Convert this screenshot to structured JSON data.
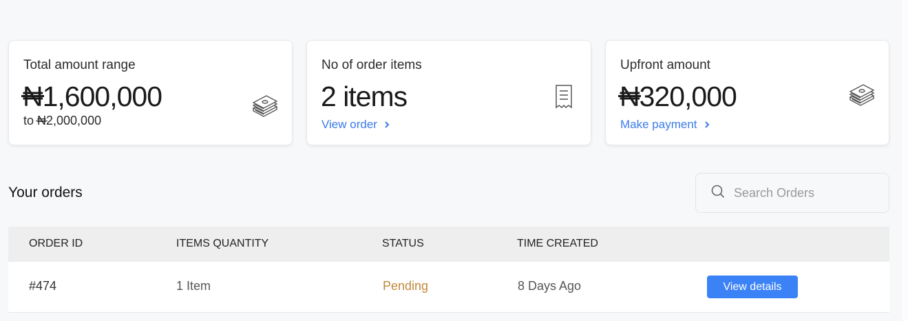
{
  "cards": {
    "total": {
      "label": "Total amount range",
      "currency": "₦",
      "amount": "1,600,000",
      "sub_prefix": "to ",
      "sub_currency": "₦",
      "sub_amount": "2,000,000"
    },
    "items": {
      "label": "No of order items",
      "value": "2 items",
      "link": "View order"
    },
    "upfront": {
      "label": "Upfront amount",
      "currency": "₦",
      "amount": "320,000",
      "link": "Make payment"
    }
  },
  "orders": {
    "title": "Your orders",
    "search_placeholder": "Search Orders",
    "columns": [
      "ORDER ID",
      "ITEMS QUANTITY",
      "STATUS",
      "TIME CREATED"
    ],
    "rows": [
      {
        "id": "#474",
        "quantity": "1 Item",
        "status": "Pending",
        "time": "8 Days Ago",
        "action": "View details"
      }
    ]
  },
  "colors": {
    "accent": "#3b82f6",
    "link": "#3b7be8",
    "pending": "#c0893a",
    "header_bg": "#eeeeef"
  },
  "icons": {
    "total": "money-stack-icon",
    "items": "receipt-icon",
    "upfront": "money-stack-icon",
    "search": "search-icon",
    "link": "chevron-right-icon"
  }
}
